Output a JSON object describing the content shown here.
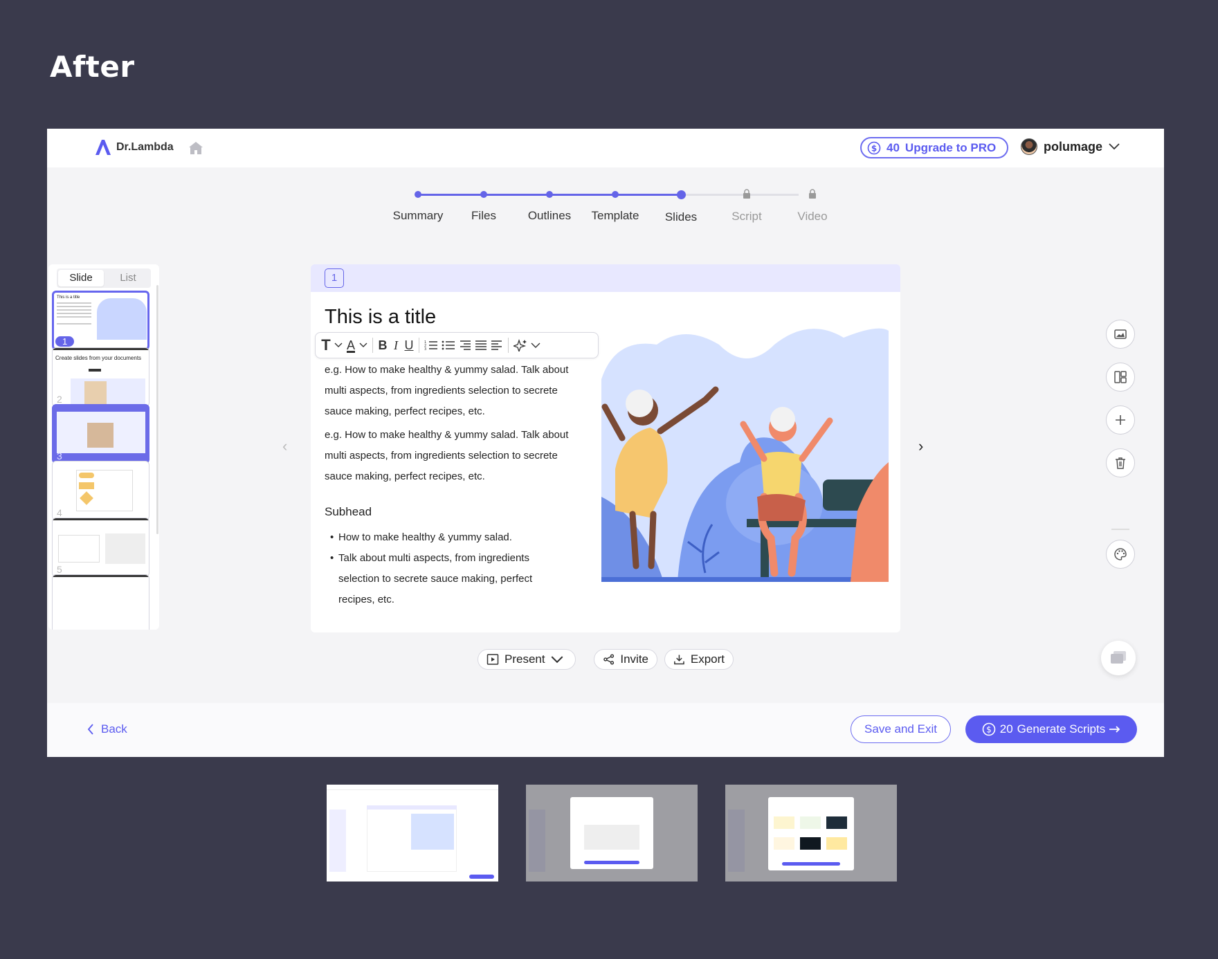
{
  "heading": "After",
  "header": {
    "brand": "Dr.Lambda",
    "credits": "40",
    "upgrade_label": "Upgrade to PRO",
    "username": "polumage"
  },
  "stepper": {
    "steps": [
      {
        "label": "Summary",
        "state": "done"
      },
      {
        "label": "Files",
        "state": "done"
      },
      {
        "label": "Outlines",
        "state": "done"
      },
      {
        "label": "Template",
        "state": "done"
      },
      {
        "label": "Slides",
        "state": "current"
      },
      {
        "label": "Script",
        "state": "locked"
      },
      {
        "label": "Video",
        "state": "locked"
      }
    ]
  },
  "sidebar": {
    "tabs": [
      "Slide",
      "List"
    ],
    "active_tab": "Slide",
    "thumbnails": [
      {
        "number": "1",
        "title": "This is a title"
      },
      {
        "number": "2",
        "title": "Create slides from your documents"
      },
      {
        "number": "3",
        "title": ""
      },
      {
        "number": "4",
        "title": ""
      },
      {
        "number": "5",
        "title": ""
      }
    ]
  },
  "slide": {
    "page_number": "1",
    "title": "This is a title",
    "paragraphs": [
      "e.g. How to make healthy & yummy salad. Talk about multi aspects, from ingredients selection to secrete sauce making, perfect recipes, etc.",
      "e.g. How to make healthy & yummy salad. Talk about multi aspects, from ingredients selection to secrete sauce making, perfect recipes, etc."
    ],
    "subhead": "Subhead",
    "bullets": [
      "How to make healthy & yummy salad.",
      "Talk about multi aspects, from ingredients selection to secrete sauce making, perfect recipes, etc."
    ]
  },
  "toolbar": {
    "present_label": "Present",
    "invite_label": "Invite",
    "export_label": "Export"
  },
  "right_tools": [
    "image-icon",
    "layout-icon",
    "plus-icon",
    "trash-icon",
    "palette-icon"
  ],
  "footer": {
    "back_label": "Back",
    "save_exit_label": "Save and Exit",
    "generate_credits": "20",
    "generate_label": "Generate Scripts"
  },
  "colors": {
    "accent": "#5b5bf0",
    "page_bg": "#3a3a4c",
    "card_head": "#e8e8ff"
  }
}
